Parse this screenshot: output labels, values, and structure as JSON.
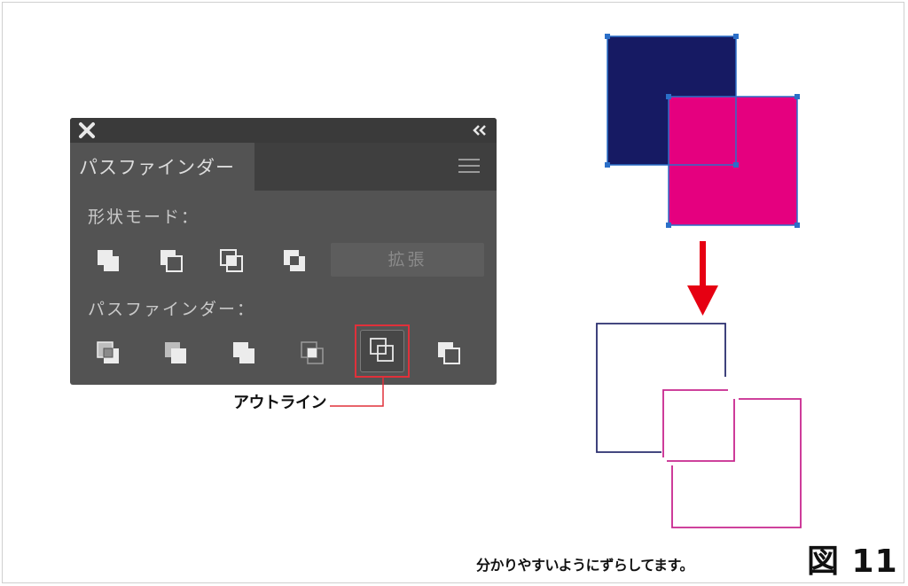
{
  "panel": {
    "tab_label": "パスファインダー",
    "shape_modes_label": "形状モード：",
    "expand_label": "拡張",
    "pathfinders_label": "パスファインダー：",
    "icons": {
      "close": "close-icon",
      "collapse": "double-chevron-left-icon",
      "menu": "hamburger-menu-icon"
    },
    "shape_mode_buttons": [
      "unite",
      "minus-front",
      "intersect",
      "exclude"
    ],
    "pathfinder_buttons": [
      "divide",
      "trim",
      "merge",
      "crop",
      "outline",
      "minus-back"
    ]
  },
  "callout": {
    "label": "アウトライン"
  },
  "caption": "分かりやすいようにずらしてます。",
  "figure_label": "図 11",
  "colors": {
    "panel_bg": "#535353",
    "navy": "#161a63",
    "magenta": "#e5007f",
    "highlight_red": "#e0303a",
    "arrow_red": "#e60012",
    "navy_outline": "#2a2e6e",
    "magenta_outline": "#c8278f"
  }
}
